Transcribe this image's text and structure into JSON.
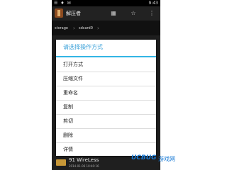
{
  "status_bar": {
    "time": "9:43"
  },
  "action_bar": {
    "title": "解压者"
  },
  "path": {
    "segments": [
      "storage",
      "sdcard0"
    ]
  },
  "dialog": {
    "title": "请选择操作方式",
    "options": [
      "打开方式",
      "压缩文件",
      "重命名",
      "复制",
      "剪切",
      "删除",
      "详情"
    ]
  },
  "file_list": {
    "last_item": {
      "name": "91 WireLess",
      "meta": "2014-01-06 10:40:16"
    }
  },
  "watermark": {
    "logo": "UCBUG",
    "text": "游戏网"
  },
  "colors": {
    "accent": "#33b5e5",
    "folder": "#c89838",
    "background": "#1f1f1f"
  }
}
